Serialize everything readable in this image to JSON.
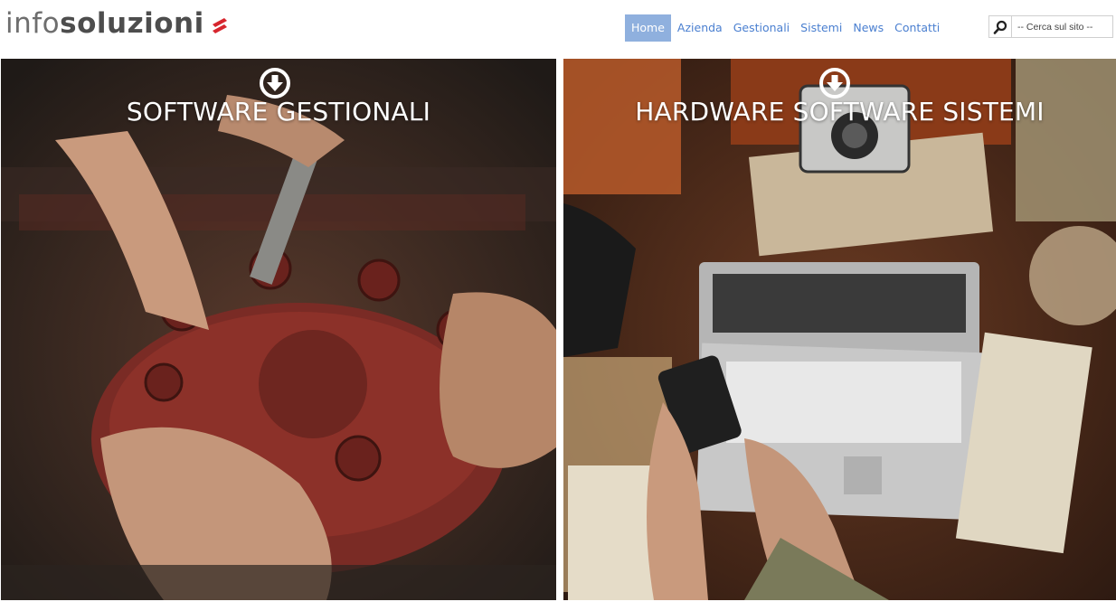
{
  "header": {
    "logo": {
      "light": "info",
      "bold": "soluzioni"
    }
  },
  "nav": {
    "items": [
      {
        "label": "Home",
        "active": true
      },
      {
        "label": "Azienda",
        "active": false
      },
      {
        "label": "Gestionali",
        "active": false
      },
      {
        "label": "Sistemi",
        "active": false
      },
      {
        "label": "News",
        "active": false
      },
      {
        "label": "Contatti",
        "active": false
      }
    ]
  },
  "search": {
    "placeholder": "-- Cerca sul sito --",
    "icon": "search-icon"
  },
  "panels": [
    {
      "title": "SOFTWARE GESTIONALI",
      "icon": "arrow-down-circle-icon"
    },
    {
      "title": "HARDWARE SOFTWARE SISTEMI",
      "icon": "arrow-down-circle-icon"
    }
  ],
  "colors": {
    "nav_link": "#4a7fd0",
    "nav_active_bg": "#8fb0de",
    "logo_mark": "#d7262e",
    "logo_text": "#4d4d4d"
  }
}
